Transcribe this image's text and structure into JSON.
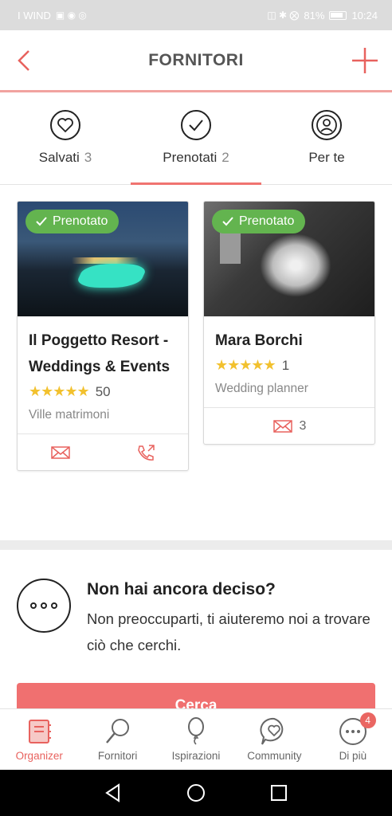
{
  "status_bar": {
    "carrier": "I WIND",
    "battery_percent": "81%",
    "time": "10:24"
  },
  "header": {
    "title": "FORNITORI"
  },
  "tabs": [
    {
      "label": "Salvati",
      "count": "3",
      "icon": "heart-icon",
      "active": false
    },
    {
      "label": "Prenotati",
      "count": "2",
      "icon": "check-icon",
      "active": true
    },
    {
      "label": "Per te",
      "count": "",
      "icon": "recommendation-icon",
      "active": false
    }
  ],
  "cards": [
    {
      "badge": "Prenotato",
      "title": "Il Poggetto Resort - Weddings & Events",
      "stars": "★★★★★",
      "rating_count": "50",
      "category": "Ville matrimoni"
    },
    {
      "badge": "Prenotato",
      "title": "Mara Borchi",
      "stars": "★★★★★",
      "rating_count": "1",
      "category": "Wedding planner",
      "message_count": "3"
    }
  ],
  "undecided": {
    "title": "Non hai ancora deciso?",
    "description": "Non preoccuparti, ti aiuteremo noi a trovare ciò che cerchi.",
    "button_label": "Cerca"
  },
  "bottom_nav": [
    {
      "label": "Organizer",
      "icon": "organizer-icon",
      "active": true
    },
    {
      "label": "Fornitori",
      "icon": "search-icon",
      "active": false
    },
    {
      "label": "Ispirazioni",
      "icon": "balloon-icon",
      "active": false
    },
    {
      "label": "Community",
      "icon": "community-icon",
      "active": false
    },
    {
      "label": "Di più",
      "icon": "more-icon",
      "active": false,
      "badge": "4"
    }
  ],
  "colors": {
    "accent": "#f07470",
    "badge_green": "#63b44f",
    "star": "#f2c12e"
  }
}
